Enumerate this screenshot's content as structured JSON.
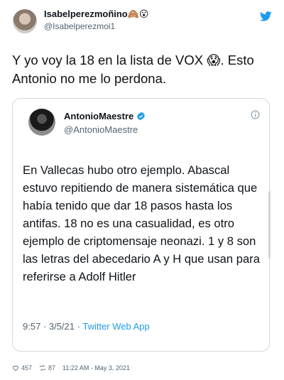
{
  "outer_tweet": {
    "display_name": "Isabelperezmoñino🙈😮",
    "handle": "@Isabelperezmoi1",
    "text": "Y yo voy la 18 en la lista de VOX 😱. Esto Antonio no me lo perdona."
  },
  "quoted_tweet": {
    "display_name": "AntonioMaestre",
    "handle": "@AntonioMaestre",
    "text": "En Vallecas hubo otro ejemplo. Abascal estuvo repitiendo de manera sistemática que había tenido que dar 18 pasos hasta los antifas. 18 no es una casualidad, es otro ejemplo de criptomensaje neonazi. 1 y 8 son las letras del abecedario A y H que usan para referirse a Adolf Hitler",
    "timestamp": "9:57 · 3/5/21 ·",
    "source": "Twitter Web App"
  },
  "footer": {
    "likes": "457",
    "retweets": "87",
    "timestamp": "11:22 AM - May 3, 2021"
  },
  "colors": {
    "accent": "#1d9bf0",
    "muted": "#536471",
    "border": "#cfd9de"
  },
  "icons": [
    "twitter-bird-icon",
    "verified-icon",
    "info-icon",
    "heart-icon",
    "retweet-icon"
  ]
}
